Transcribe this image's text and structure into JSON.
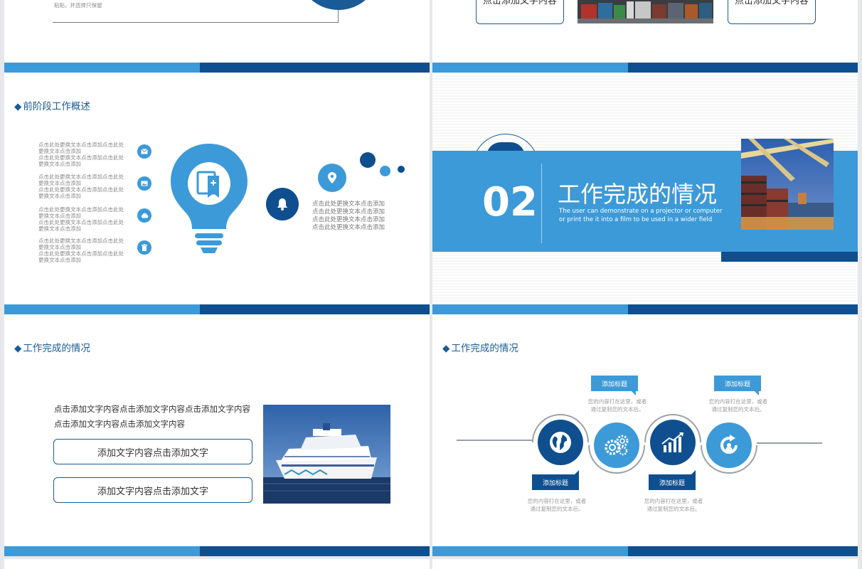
{
  "slide1": {
    "small_text": "粘贴，并选择只保留"
  },
  "slide2": {
    "btn_left": "点击添加文字内容",
    "btn_right": "点击添加文字内容"
  },
  "slide3": {
    "heading": "前阶段工作概述",
    "left_items": [
      {
        "icon": "mail-icon",
        "text": "点击此处更换文本点击添加点击此处更换文本点击添加\n点击此处更换文本点击添加点击此处更换文本点击添加"
      },
      {
        "icon": "image-icon",
        "text": "点击此处更换文本点击添加点击此处更换文本点击添加\n点击此处更换文本点击添加点击此处更换文本点击添加"
      },
      {
        "icon": "cloud-icon",
        "text": "点击此处更换文本点击添加点击此处更换文本点击添加\n点击此处更换文本点击添加点击此处更换文本点击添加"
      },
      {
        "icon": "trash-icon",
        "text": "点击此处更换文本点击添加点击此处更换文本点击添加\n点击此处更换文本点击添加点击此处更换文本点击添加"
      }
    ],
    "right_text": "点击此处更换文本点击添加\n点击此处更换文本点击添加\n点击此处更换文本点击添加\n点击此处更换文本点击添加"
  },
  "slide4": {
    "number": "02",
    "title": "工作完成的情况",
    "subtitle_line1": "The user can demonstrate on a projector or computer",
    "subtitle_line2": "or print the it into a film to be used in a wider field"
  },
  "slide5": {
    "heading": "工作完成的情况",
    "body_line1": "点击添加文字内容点击添加文字内容点击添加文字内容",
    "body_line2": "点击添加文字内容点击添加文字内容",
    "button1": "添加文字内容点击添加文字",
    "button2": "添加文字内容点击添加文字"
  },
  "slide6": {
    "heading": "工作完成的情况",
    "tags": [
      {
        "label": "添加标题",
        "desc": "您的内容打在这里，或者\n通过复制您的文本后。"
      },
      {
        "label": "添加标题",
        "desc": "您的内容打在这里，或者\n通过复制您的文本后。"
      },
      {
        "label": "添加标题",
        "desc": "您的内容打在这里，或者\n通过复制您的文本后。"
      },
      {
        "label": "添加标题",
        "desc": "您的内容打在这里，或者\n通过复制您的文本后。"
      }
    ],
    "icons": [
      "globe-icon",
      "gears-icon",
      "chart-icon",
      "refresh-icon"
    ]
  },
  "colors": {
    "light_blue": "#3c9ad8",
    "dark_blue": "#0f4f8f",
    "heading_blue": "#1a5b96"
  }
}
